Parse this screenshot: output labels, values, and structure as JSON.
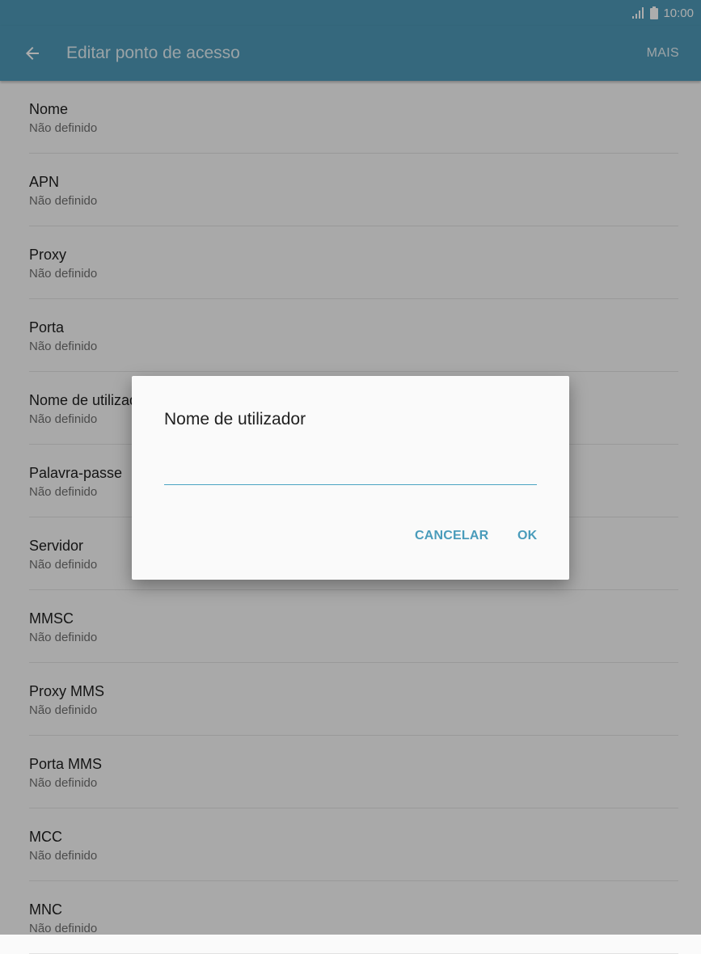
{
  "status_bar": {
    "time": "10:00",
    "icons": [
      "signal-icon",
      "battery-icon"
    ]
  },
  "app_bar": {
    "back_icon": "back-arrow-icon",
    "title": "Editar ponto de acesso",
    "more_label": "MAIS",
    "color": "#4e9ab8"
  },
  "list": {
    "items": [
      {
        "title": "Nome",
        "summary": "Não definido"
      },
      {
        "title": "APN",
        "summary": "Não definido"
      },
      {
        "title": "Proxy",
        "summary": "Não definido"
      },
      {
        "title": "Porta",
        "summary": "Não definido"
      },
      {
        "title": "Nome de utilizador",
        "summary": "Não definido"
      },
      {
        "title": "Palavra-passe",
        "summary": "Não definido"
      },
      {
        "title": "Servidor",
        "summary": "Não definido"
      },
      {
        "title": "MMSC",
        "summary": "Não definido"
      },
      {
        "title": "Proxy MMS",
        "summary": "Não definido"
      },
      {
        "title": "Porta MMS",
        "summary": "Não definido"
      },
      {
        "title": "MCC",
        "summary": "Não definido"
      },
      {
        "title": "MNC",
        "summary": "Não definido"
      }
    ]
  },
  "dialog": {
    "title": "Nome de utilizador",
    "input_value": "",
    "cancel_label": "CANCELAR",
    "ok_label": "OK",
    "accent_color": "#4a9cbb"
  }
}
